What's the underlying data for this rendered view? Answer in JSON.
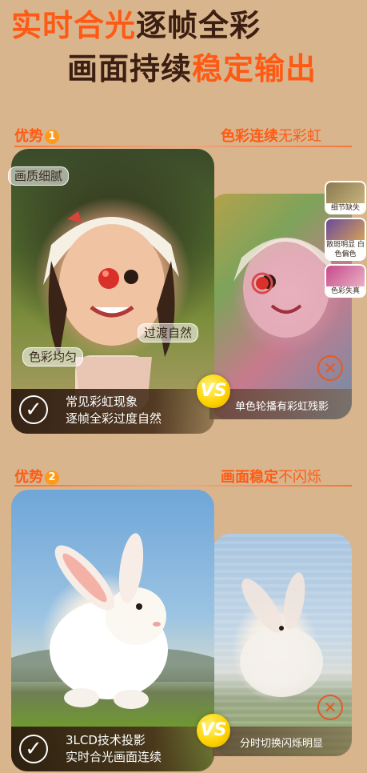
{
  "headline": {
    "line1_orange": "实时合光",
    "line1_dark": "逐帧全彩",
    "line2_dark": "画面持续",
    "line2_orange": "稳定输出"
  },
  "section1": {
    "label": "优势",
    "num": "1",
    "right_bold": "色彩连续",
    "right_light": "无彩虹",
    "tags": [
      "画质细腻",
      "过渡自然",
      "色彩均匀"
    ],
    "thumbs": [
      "细节缺失",
      "散斑明显 白色偏色",
      "色彩失真"
    ],
    "left_caption_line1": "常见彩虹现象",
    "left_caption_line2": "逐帧全彩过度自然",
    "right_caption": "单色轮播有彩虹残影",
    "vs": "VS"
  },
  "section2": {
    "label": "优势",
    "num": "2",
    "right_bold": "画面稳定",
    "right_light": "不闪烁",
    "left_caption_line1": "3LCD技术投影",
    "left_caption_line2": "实时合光画面连续",
    "right_caption": "分时切换闪烁明显",
    "vs": "VS"
  },
  "colors": {
    "background": "#d9b58d",
    "accent_orange": "#ff5a14",
    "dark_brown": "#3b1f12"
  }
}
